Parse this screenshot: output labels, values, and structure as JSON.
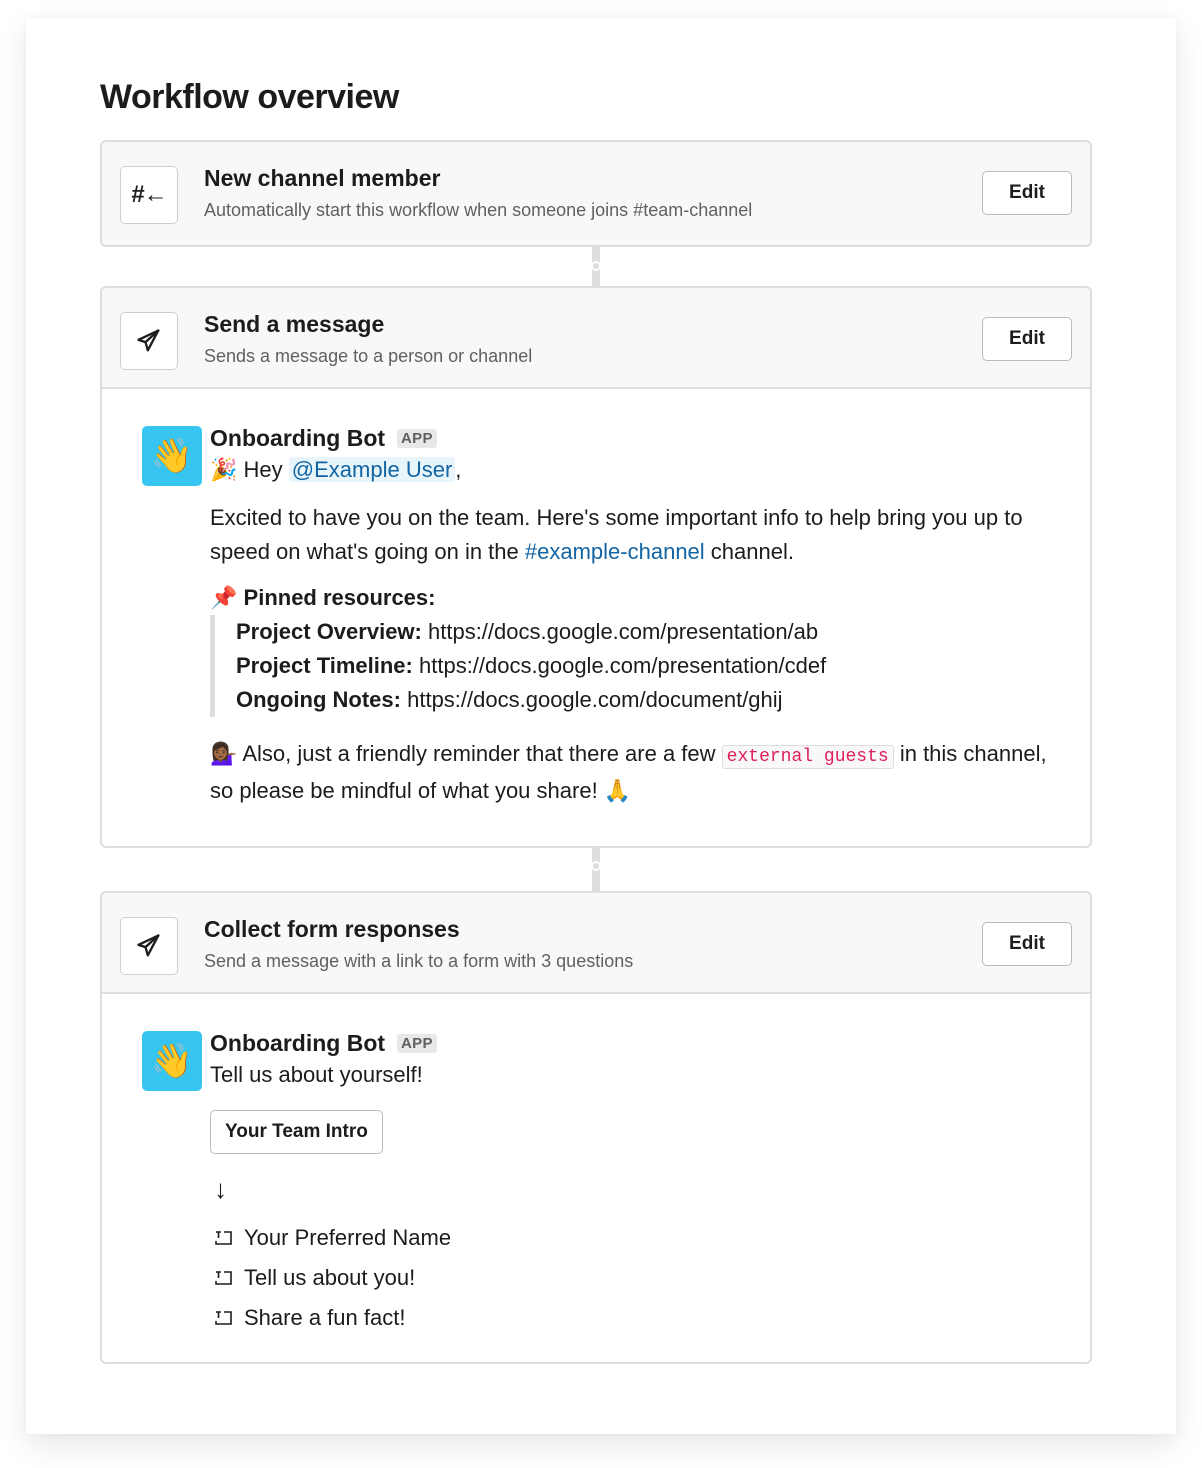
{
  "page": {
    "title": "Workflow overview"
  },
  "steps": [
    {
      "icon": "hash-join-icon",
      "icon_glyph": "#←",
      "title": "New channel member",
      "description": "Automatically start this workflow when someone joins #team-channel",
      "edit_label": "Edit"
    },
    {
      "icon": "paper-plane-icon",
      "title": "Send a message",
      "description": "Sends a message to a person or channel",
      "edit_label": "Edit",
      "message": {
        "sender": "Onboarding Bot",
        "badge": "APP",
        "avatar_emoji": "👋",
        "greeting_emoji": "🎉",
        "greeting_prefix": "Hey",
        "mention": "@Example User",
        "greeting_suffix": ",",
        "para1_part1": "Excited to have you on the team. Here's some important info to help bring you up to speed on what's going on in the",
        "para1_channel": "#example-channel",
        "para1_part2": "channel.",
        "pinned_emoji": "📌",
        "pinned_heading": "Pinned resources:",
        "resources": [
          {
            "label": "Project Overview:",
            "url": "https://docs.google.com/presentation/ab"
          },
          {
            "label": "Project Timeline:",
            "url": "https://docs.google.com/presentation/cdef"
          },
          {
            "label": "Ongoing Notes:",
            "url": "https://docs.google.com/document/ghij"
          }
        ],
        "reminder_emoji": "💁🏾‍♀️",
        "reminder_part1": "Also, just a friendly reminder that there are a few",
        "reminder_code": "external guests",
        "reminder_part2": "in this channel, so please be mindful of what you share!",
        "reminder_end_emoji": "🙏"
      }
    },
    {
      "icon": "paper-plane-icon",
      "title": "Collect form responses",
      "description": "Send a message with a link to a form with 3 questions",
      "edit_label": "Edit",
      "message": {
        "sender": "Onboarding Bot",
        "badge": "APP",
        "avatar_emoji": "👋",
        "text": "Tell us about yourself!",
        "button_label": "Your Team Intro",
        "arrow": "↓",
        "fields": [
          "Your Preferred Name",
          "Tell us about you!",
          "Share a fun fact!"
        ]
      }
    }
  ],
  "colors": {
    "link": "#1264a3",
    "code": "#e01e5a",
    "avatar_bg": "#36c5f0",
    "border": "#dddddd"
  }
}
